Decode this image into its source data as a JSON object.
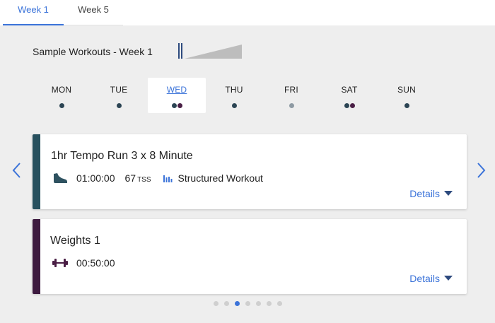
{
  "tabs": [
    {
      "label": "Week 1",
      "active": true
    },
    {
      "label": "Week 5",
      "active": false
    }
  ],
  "title": "Sample Workouts - Week 1",
  "days": [
    {
      "label": "MON",
      "dots": [
        "#2b4453"
      ]
    },
    {
      "label": "TUE",
      "dots": [
        "#2b4453"
      ]
    },
    {
      "label": "WED",
      "dots": [
        "#2b4453",
        "#4a1f45"
      ],
      "selected": true
    },
    {
      "label": "THU",
      "dots": [
        "#2b4453"
      ]
    },
    {
      "label": "FRI",
      "dots": [
        "#8e9aa3"
      ]
    },
    {
      "label": "SAT",
      "dots": [
        "#2b4453",
        "#4a1f45"
      ]
    },
    {
      "label": "SUN",
      "dots": [
        "#2b4453"
      ]
    }
  ],
  "workouts": [
    {
      "name": "1hr Tempo Run 3 x 8 Minute",
      "duration": "01:00:00",
      "tss_value": "67",
      "tss_unit": "TSS",
      "type_label": "Structured Workout",
      "details_label": "Details",
      "color": "#27505e",
      "icon": "running-shoe-icon"
    },
    {
      "name": "Weights 1",
      "duration": "00:50:00",
      "details_label": "Details",
      "color": "#3d1a3f",
      "icon": "dumbbell-icon"
    }
  ],
  "pager": {
    "count": 7,
    "active_index": 2
  },
  "colors": {
    "accent": "#3b73d9",
    "background": "#eeeeee"
  }
}
